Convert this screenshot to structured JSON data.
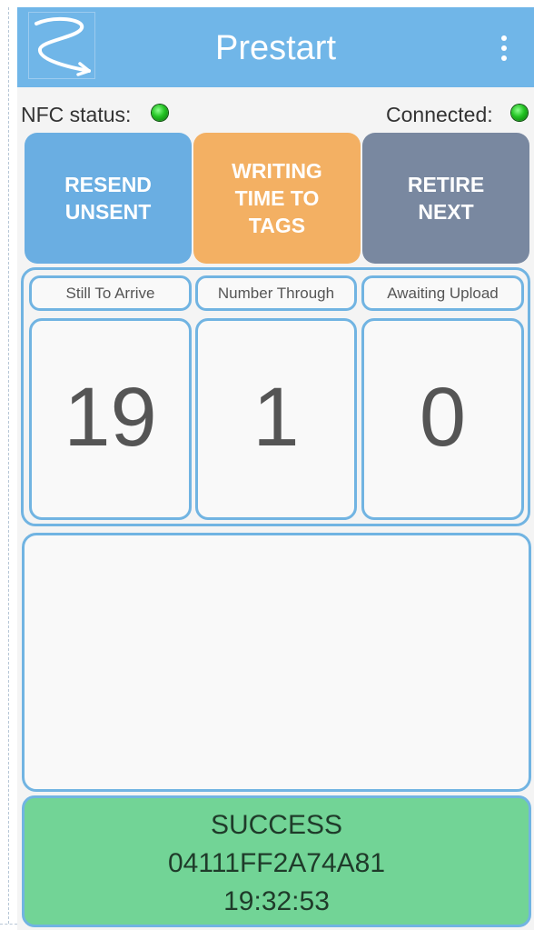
{
  "appbar": {
    "title": "Prestart",
    "logo_icon": "app-logo-swoosh-arrow",
    "menu_icon": "more-vertical-icon"
  },
  "status": {
    "nfc_label": "NFC status:",
    "nfc_indicator": "green",
    "connected_label": "Connected:",
    "connected_indicator": "green"
  },
  "actions": [
    {
      "label": "RESEND UNSENT",
      "color": "#6aaee2"
    },
    {
      "label": "WRITING TIME TO TAGS",
      "color": "#f3b063"
    },
    {
      "label": "RETIRE NEXT",
      "color": "#7988a0"
    }
  ],
  "counters": [
    {
      "label": "Still To Arrive",
      "value": "19"
    },
    {
      "label": "Number Through",
      "value": "1"
    },
    {
      "label": "Awaiting Upload",
      "value": "0"
    }
  ],
  "result": {
    "status": "SUCCESS",
    "tag_id": "04111FF2A74A81",
    "time": "19:32:53"
  },
  "colors": {
    "accent": "#70b6e8",
    "border": "#71b4e2",
    "success": "#72d496",
    "indicator_on": "#22c322"
  }
}
